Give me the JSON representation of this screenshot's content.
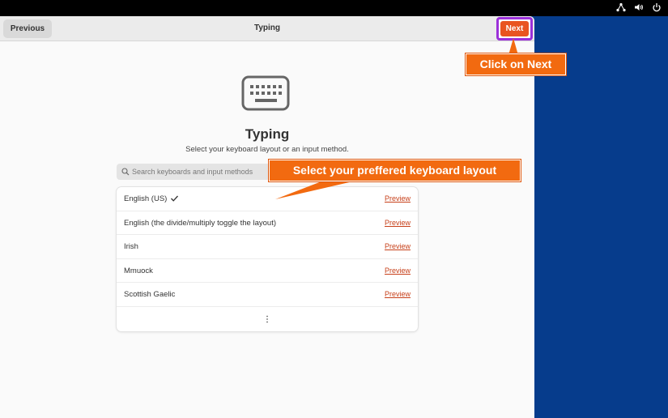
{
  "header": {
    "previous_label": "Previous",
    "title": "Typing",
    "next_label": "Next"
  },
  "main": {
    "icon": "keyboard-icon",
    "title": "Typing",
    "subtitle": "Select your keyboard layout or an input method."
  },
  "search": {
    "placeholder": "Search keyboards and input methods"
  },
  "layouts": [
    {
      "label": "English (US)",
      "selected": true,
      "preview": "Preview"
    },
    {
      "label": "English (the divide/multiply toggle the layout)",
      "selected": false,
      "preview": "Preview"
    },
    {
      "label": "Irish",
      "selected": false,
      "preview": "Preview"
    },
    {
      "label": "Mmuock",
      "selected": false,
      "preview": "Preview"
    },
    {
      "label": "Scottish Gaelic",
      "selected": false,
      "preview": "Preview"
    }
  ],
  "annotations": {
    "next": "Click on Next",
    "layout": "Select your preffered keyboard layout"
  },
  "system_tray": [
    "network-icon",
    "volume-icon",
    "power-icon"
  ],
  "colors": {
    "accent": "#e95420",
    "annotation": "#f26a10",
    "highlight_border": "#9b30d9",
    "desktop": "#063c8c",
    "link": "#c7401a"
  }
}
